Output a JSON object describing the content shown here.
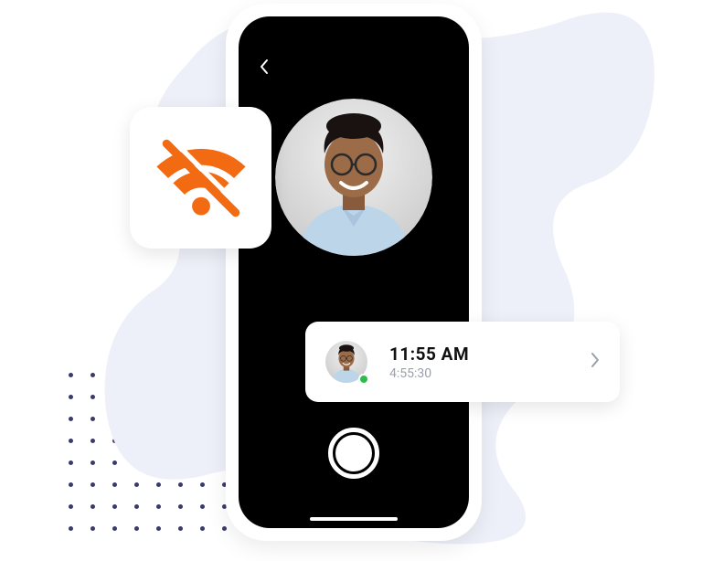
{
  "phone": {
    "back_icon_name": "back-chevron-icon",
    "shutter_name": "camera-shutter-button"
  },
  "wifi_card": {
    "icon_name": "wifi-off-icon"
  },
  "entry": {
    "time": "11:55 AM",
    "duration": "4:55:30",
    "status": "online",
    "status_color": "#2bbd4a",
    "chevron_name": "chevron-right-icon"
  }
}
